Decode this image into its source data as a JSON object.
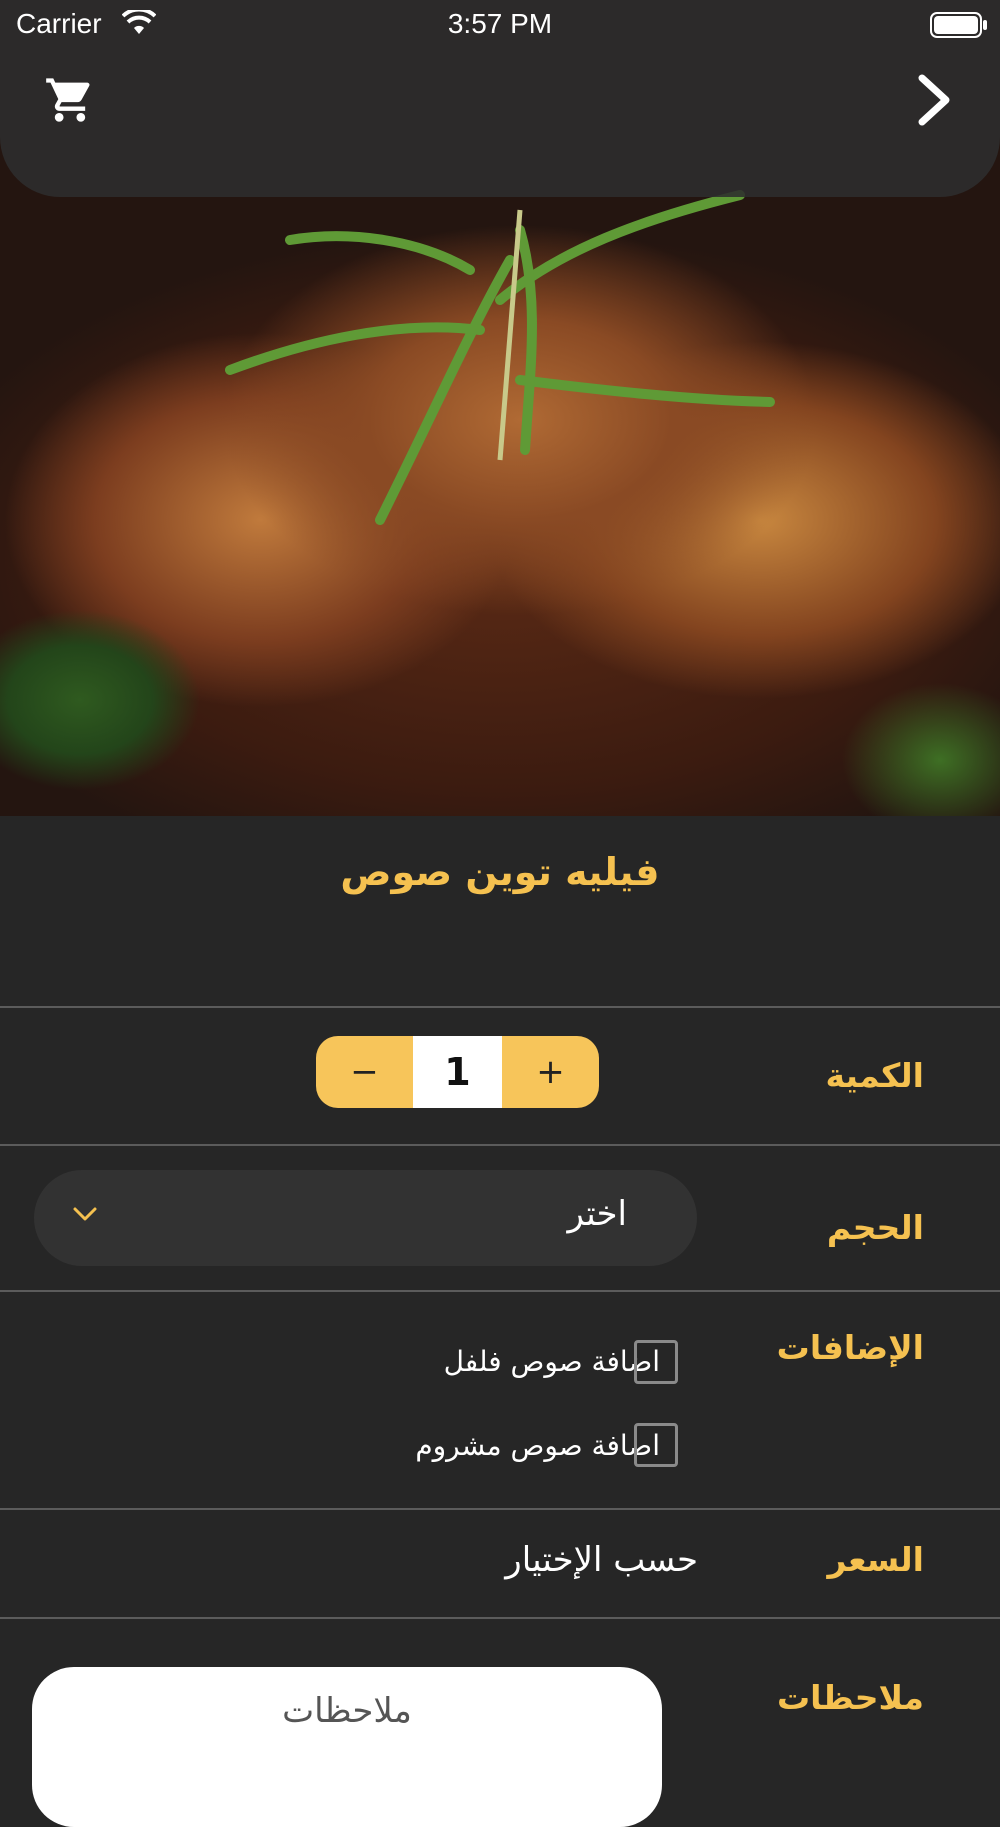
{
  "status_bar": {
    "carrier": "Carrier",
    "time": "3:57 PM"
  },
  "product": {
    "title": "فيليه توين صوص"
  },
  "quantity": {
    "label": "الكمية",
    "value": "1",
    "minus": "−",
    "plus": "+"
  },
  "size": {
    "label": "الحجم",
    "selected": "اختر"
  },
  "addons": {
    "label": "الإضافات",
    "items": [
      {
        "label": "اضافة صوص فلفل",
        "checked": false
      },
      {
        "label": "اضافة صوص مشروم",
        "checked": false
      }
    ]
  },
  "price": {
    "label": "السعر",
    "value": "حسب الإختيار"
  },
  "notes": {
    "label": "ملاحظات",
    "placeholder": "ملاحظات"
  },
  "colors": {
    "accent": "#f5c150",
    "background": "#262626",
    "stepper": "#f7c55a"
  }
}
